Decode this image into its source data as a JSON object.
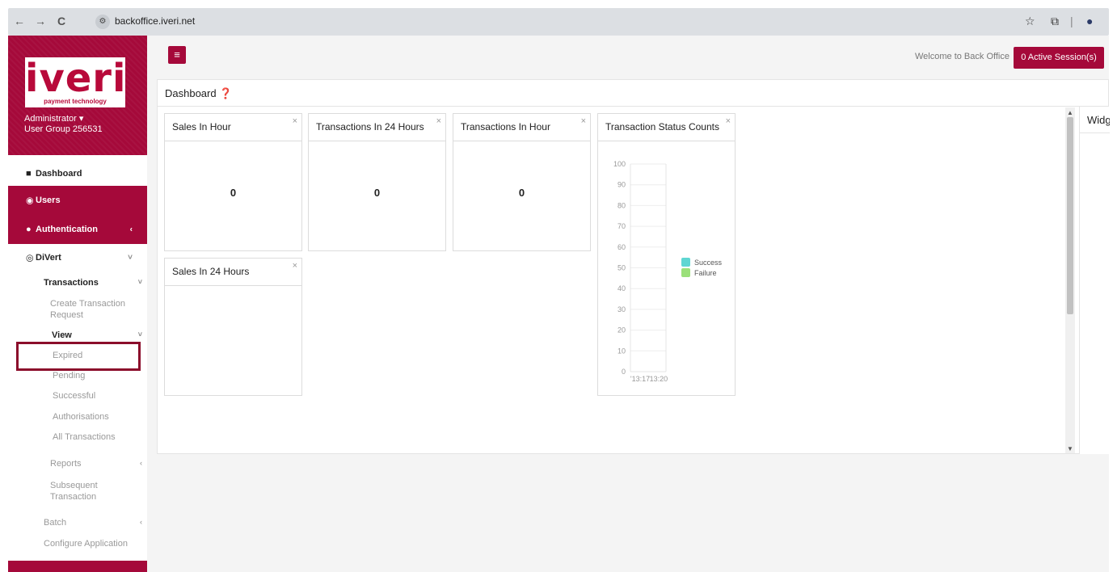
{
  "browser": {
    "url": "backoffice.iveri.net",
    "back_icon": "←",
    "forward_icon": "→",
    "reload_icon": "C",
    "site_info_icon": "⚙",
    "star_icon": "☆",
    "extension_icon": "⧉",
    "divider": "|",
    "profile_icon": "●"
  },
  "sidebar": {
    "logo_word": "iveri",
    "logo_tagline": "payment technology",
    "user_role": "Administrator ▾",
    "user_group": "User Group 256531",
    "items": {
      "dashboard": "Dashboard",
      "users": "Users",
      "authentication": "Authentication",
      "divert": "DiVert",
      "transactions": "Transactions",
      "create_request": [
        "Create Transaction",
        "Request"
      ],
      "view": "View",
      "expired": "Expired",
      "pending": "Pending",
      "successful": "Successful",
      "authorisations": "Authorisations",
      "all_transactions": "All Transactions",
      "reports": "Reports",
      "subsequent": [
        "Subsequent",
        "Transaction"
      ],
      "batch": "Batch",
      "configure_application": "Configure Application"
    },
    "icons": {
      "dashboard": "■",
      "users": "◉",
      "authentication": "●",
      "divert": "◎",
      "chevron_left": "‹",
      "chevron_down": "˅"
    }
  },
  "header": {
    "menu_icon": "≡",
    "welcome": "Welcome to Back Office",
    "sessions_button": "0 Active Session(s)"
  },
  "dashboard": {
    "title": "Dashboard ❓",
    "close_icon": "×",
    "widgets": {
      "sales_hour": {
        "title": "Sales In Hour",
        "value": "0"
      },
      "tx_24h": {
        "title": "Transactions In 24 Hours",
        "value": "0"
      },
      "tx_hour": {
        "title": "Transactions In Hour",
        "value": "0"
      },
      "status_counts": {
        "title": "Transaction Status Counts"
      },
      "sales_24h": {
        "title": "Sales In 24 Hours"
      }
    },
    "side_panel_title": "Widgets"
  },
  "chart_data": {
    "type": "bar",
    "categories": [
      "13:17",
      "13:20"
    ],
    "series": [
      {
        "name": "Success",
        "values": [
          0,
          0
        ],
        "color": "#5fd6d2"
      },
      {
        "name": "Failure",
        "values": [
          0,
          0
        ],
        "color": "#9be07a"
      }
    ],
    "ylim": [
      0,
      100
    ],
    "yticks": [
      0,
      10,
      20,
      30,
      40,
      50,
      60,
      70,
      80,
      90,
      100
    ],
    "xticklabels": [
      "'13:17",
      "'13:20"
    ],
    "legend_placement": "right"
  }
}
